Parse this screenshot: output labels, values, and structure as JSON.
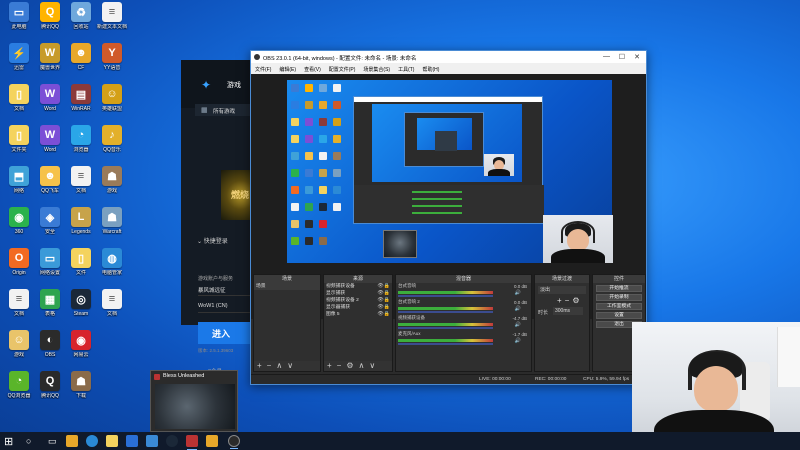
{
  "desktop": {
    "icons": [
      {
        "label": "此电脑",
        "glyph": "▭",
        "color": "#3a7bd5",
        "col": 0,
        "row": 0
      },
      {
        "label": "腾讯QQ",
        "glyph": "Q",
        "color": "#ffb400",
        "col": 1,
        "row": 0
      },
      {
        "label": "回收站",
        "glyph": "♻",
        "color": "#6fa8dc",
        "col": 2,
        "row": 0
      },
      {
        "label": "新建文本文档",
        "glyph": "≡",
        "color": "#f2f2f2",
        "col": 3,
        "row": 0
      },
      {
        "label": "迅雷",
        "glyph": "⚡",
        "color": "#2a7de1",
        "col": 0,
        "row": 1
      },
      {
        "label": "魔兽世界",
        "glyph": "W",
        "color": "#c79b2a",
        "col": 1,
        "row": 1
      },
      {
        "label": "CF",
        "glyph": "☻",
        "color": "#e8a82a",
        "col": 2,
        "row": 1
      },
      {
        "label": "YY语音",
        "glyph": "Y",
        "color": "#d05a2a",
        "col": 3,
        "row": 1
      },
      {
        "label": "文档",
        "glyph": "▯",
        "color": "#f4d35e",
        "col": 0,
        "row": 2
      },
      {
        "label": "Word",
        "glyph": "W",
        "color": "#7b4fd6",
        "col": 1,
        "row": 2
      },
      {
        "label": "WinRAR",
        "glyph": "▤",
        "color": "#8b3a3a",
        "col": 2,
        "row": 2
      },
      {
        "label": "英雄联盟",
        "glyph": "☺",
        "color": "#d4a017",
        "col": 3,
        "row": 2
      },
      {
        "label": "文件夹",
        "glyph": "▯",
        "color": "#f4d35e",
        "col": 0,
        "row": 3
      },
      {
        "label": "Word",
        "glyph": "W",
        "color": "#7b4fd6",
        "col": 1,
        "row": 3
      },
      {
        "label": "浏览器",
        "glyph": "◔",
        "color": "#2aa6e8",
        "col": 2,
        "row": 3
      },
      {
        "label": "QQ音乐",
        "glyph": "♪",
        "color": "#e3b02a",
        "col": 3,
        "row": 3
      },
      {
        "label": "网络",
        "glyph": "⬒",
        "color": "#3fa2d8",
        "col": 0,
        "row": 4
      },
      {
        "label": "QQ飞车",
        "glyph": "☻",
        "color": "#f6c24a",
        "col": 1,
        "row": 4
      },
      {
        "label": "文档",
        "glyph": "≡",
        "color": "#f2f2f2",
        "col": 2,
        "row": 4
      },
      {
        "label": "游戏",
        "glyph": "☗",
        "color": "#9a7b5a",
        "col": 3,
        "row": 4
      },
      {
        "label": "360",
        "glyph": "◉",
        "color": "#2bb24c",
        "col": 0,
        "row": 5
      },
      {
        "label": "安全",
        "glyph": "◈",
        "color": "#3a7bd5",
        "col": 1,
        "row": 5
      },
      {
        "label": "Legends",
        "glyph": "L",
        "color": "#c7a34a",
        "col": 2,
        "row": 5
      },
      {
        "label": "Warcraft",
        "glyph": "☗",
        "color": "#7aa0c0",
        "col": 3,
        "row": 5
      },
      {
        "label": "Origin",
        "glyph": "O",
        "color": "#f26a22",
        "col": 0,
        "row": 6
      },
      {
        "label": "网络设置",
        "glyph": "▭",
        "color": "#3a9ad9",
        "col": 1,
        "row": 6
      },
      {
        "label": "文件",
        "glyph": "▯",
        "color": "#f4d35e",
        "col": 2,
        "row": 6
      },
      {
        "label": "电脑管家",
        "glyph": "◍",
        "color": "#2b8ad6",
        "col": 3,
        "row": 6
      },
      {
        "label": "文档",
        "glyph": "≡",
        "color": "#f2f2f2",
        "col": 0,
        "row": 7
      },
      {
        "label": "表格",
        "glyph": "▦",
        "color": "#2ea44f",
        "col": 1,
        "row": 7
      },
      {
        "label": "Steam",
        "glyph": "◎",
        "color": "#1b2838",
        "col": 2,
        "row": 7
      },
      {
        "label": "文档",
        "glyph": "≡",
        "color": "#f2f2f2",
        "col": 3,
        "row": 7
      },
      {
        "label": "游戏",
        "glyph": "☺",
        "color": "#e9c46a",
        "col": 0,
        "row": 8
      },
      {
        "label": "OBS",
        "glyph": "◐",
        "color": "#2b2b2b",
        "col": 1,
        "row": 8
      },
      {
        "label": "网易云",
        "glyph": "◉",
        "color": "#d7242c",
        "col": 2,
        "row": 8
      },
      {
        "label": "QQ浏览器",
        "glyph": "◔",
        "color": "#5ab52a",
        "col": 0,
        "row": 9
      },
      {
        "label": "腾讯QQ",
        "glyph": "Q",
        "color": "#2a2a2a",
        "col": 1,
        "row": 9
      },
      {
        "label": "下载",
        "glyph": "☗",
        "color": "#8a6b4a",
        "col": 2,
        "row": 9
      }
    ]
  },
  "launcher": {
    "brand": "游戏",
    "tab": "所有游戏",
    "art_text": "燃烧",
    "quick_login": "快捷登录",
    "account_label": "游戏账户与服务",
    "account_value": "暴风城远征",
    "realm": "WoW1 (CN)",
    "play_button": "进入",
    "version": "版本: 2.5.1.39603",
    "status": "3个月"
  },
  "obs": {
    "title": "OBS 23.0.1 (64-bit, windows) - 配置文件: 未命名 - 场景: 未命名",
    "menu": [
      "文件(F)",
      "编辑(E)",
      "查看(V)",
      "配置文件(P)",
      "场景集合(S)",
      "工具(T)",
      "帮助(H)"
    ],
    "panels": {
      "scenes": "场景",
      "sources": "来源",
      "mixer": "混音器",
      "transitions": "场景过渡",
      "controls": "控件"
    },
    "scenes": [
      "场景"
    ],
    "sources": [
      "视频捕获设备",
      "显示捕获",
      "视频捕获设备 2",
      "显示器捕获",
      "图像 5"
    ],
    "mixer": [
      {
        "name": "台式音响",
        "db": "0.0 dB"
      },
      {
        "name": "台式音响 2",
        "db": "0.0 dB"
      },
      {
        "name": "视频捕获设备",
        "db": "-4.7 dB"
      },
      {
        "name": "麦克风/Aux",
        "db": "-1.7 dB"
      }
    ],
    "transition_name": "淡出",
    "duration_label": "时长",
    "duration_value": "300ms",
    "controls": [
      "开始推流",
      "开始录制",
      "工作室模式",
      "设置",
      "退出"
    ],
    "status": {
      "live": "LIVE: 00:00:00",
      "rec": "REC: 00:00:00",
      "cpu": "CPU: 5.9%, 59.94 fps"
    }
  },
  "thumbnail": {
    "title": "Bless Unleashed"
  },
  "colors": {
    "accent": "#1b79e8",
    "obs_bg": "#2b2b2b",
    "desktop_blue": "#1877e8"
  }
}
